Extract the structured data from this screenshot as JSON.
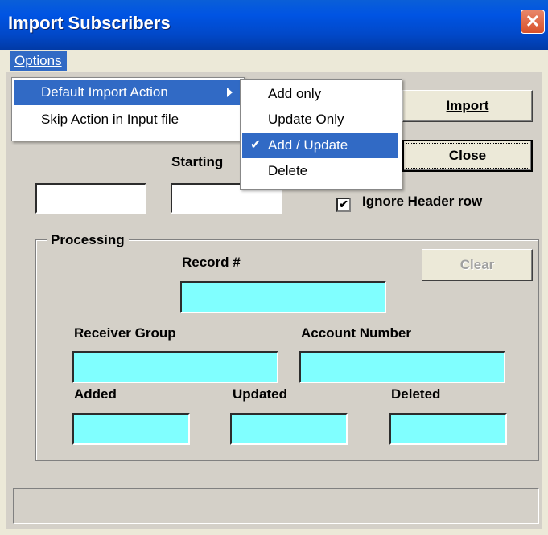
{
  "window": {
    "title": "Import Subscribers",
    "close_glyph": "✕"
  },
  "menubar": {
    "options_label": "Options"
  },
  "options_menu": {
    "items": [
      {
        "label": "Default Import Action",
        "has_submenu": true,
        "selected": true
      },
      {
        "label": "Skip Action in Input file",
        "has_submenu": false,
        "selected": false
      }
    ]
  },
  "import_action_submenu": {
    "items": [
      {
        "label": "Add only",
        "checked": false
      },
      {
        "label": "Update Only",
        "checked": false
      },
      {
        "label": "Add / Update",
        "checked": true
      },
      {
        "label": "Delete",
        "checked": false
      }
    ],
    "check_glyph": "✔"
  },
  "buttons": {
    "import_label": "Import",
    "close_label": "Close",
    "clear_label": "Clear"
  },
  "fields": {
    "starting_label": "Starting",
    "ignore_header_label": "Ignore Header row",
    "ignore_header_checked": true,
    "checkbox_glyph": "✔"
  },
  "processing": {
    "group_title": "Processing",
    "record_label": "Record #",
    "receiver_group_label": "Receiver Group",
    "account_number_label": "Account Number",
    "added_label": "Added",
    "updated_label": "Updated",
    "deleted_label": "Deleted"
  },
  "colors": {
    "titlebar": "#0054e3",
    "menu_highlight": "#316ac5",
    "readonly_field": "#80ffff"
  }
}
